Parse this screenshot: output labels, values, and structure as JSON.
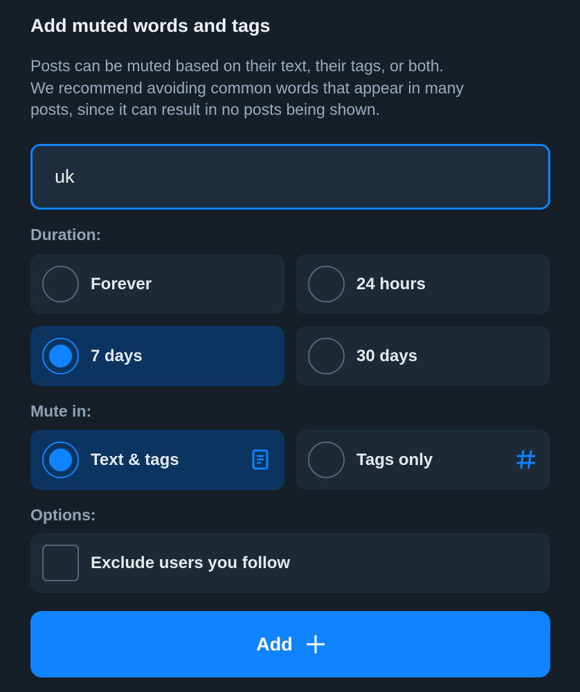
{
  "dialog": {
    "title": "Add muted words and tags",
    "description_lines": [
      "Posts can be muted based on their text, their tags, or both.",
      "We recommend avoiding common words that appear in many",
      "posts, since it can result in no posts being shown."
    ],
    "input": {
      "value": "uk",
      "placeholder": ""
    }
  },
  "duration": {
    "label": "Duration:",
    "options": [
      {
        "label": "Forever",
        "selected": false
      },
      {
        "label": "24 hours",
        "selected": false
      },
      {
        "label": "7 days",
        "selected": true
      },
      {
        "label": "30 days",
        "selected": false
      }
    ]
  },
  "mute_in": {
    "label": "Mute in:",
    "options": [
      {
        "label": "Text & tags",
        "selected": true,
        "icon": "document-icon"
      },
      {
        "label": "Tags only",
        "selected": false,
        "icon": "hashtag-icon"
      }
    ]
  },
  "options": {
    "label": "Options:",
    "exclude_following": {
      "label": "Exclude users you follow",
      "checked": false
    }
  },
  "add_button": {
    "label": "Add",
    "icon": "plus-icon"
  },
  "colors": {
    "background": "#161e27",
    "accent": "#1083fe",
    "selected_option": "#0c3460",
    "option": "#1e2936"
  }
}
